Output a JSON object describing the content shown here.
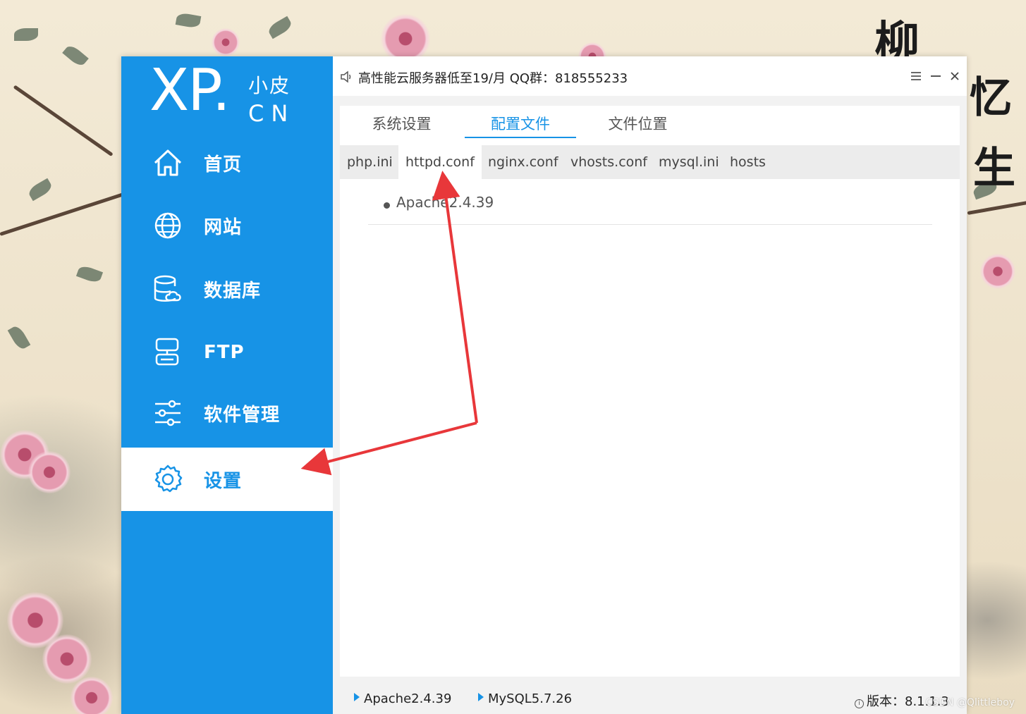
{
  "app": {
    "logo_main": "XP.",
    "logo_small_top": "小皮",
    "logo_small_bottom": "CN",
    "title": "高性能云服务器低至19/月  QQ群：818555233"
  },
  "sidebar": {
    "items": [
      {
        "label": "首页",
        "icon": "home-icon"
      },
      {
        "label": "网站",
        "icon": "globe-icon"
      },
      {
        "label": "数据库",
        "icon": "database-icon"
      },
      {
        "label": "FTP",
        "icon": "ftp-icon"
      },
      {
        "label": "软件管理",
        "icon": "sliders-icon"
      },
      {
        "label": "设置",
        "icon": "gear-icon",
        "active": true
      }
    ]
  },
  "tabs": [
    "系统设置",
    "配置文件",
    "文件位置"
  ],
  "active_tab": "配置文件",
  "subtabs": [
    "php.ini",
    "httpd.conf",
    "nginx.conf",
    "vhosts.conf",
    "mysql.ini",
    "hosts"
  ],
  "active_subtab": "httpd.conf",
  "content": {
    "items": [
      "Apache2.4.39"
    ]
  },
  "status": {
    "apache": "Apache2.4.39",
    "mysql": "MySQL5.7.26",
    "version": "版本：8.1.1.3"
  },
  "watermark": "CSDN @Qlittleboy",
  "colors": {
    "accent": "#1793e6",
    "annotation_arrow": "#e8373a"
  }
}
